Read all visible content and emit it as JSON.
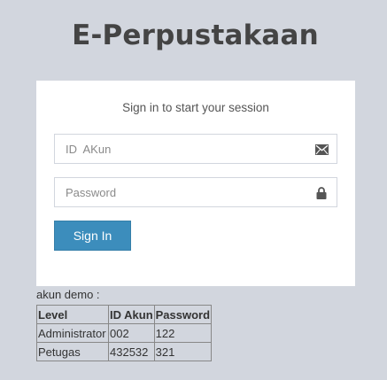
{
  "app": {
    "title": "E-Perpustakaan"
  },
  "login": {
    "message": "Sign in to start your session",
    "id_field": {
      "placeholder": "ID  AKun",
      "value": ""
    },
    "password_field": {
      "placeholder": "Password",
      "value": ""
    },
    "submit_label": "Sign In"
  },
  "icons": {
    "id_field_icon": "envelope-icon",
    "password_field_icon": "lock-icon"
  },
  "colors": {
    "background": "#d2d6de",
    "primary_button": "#3c8dbc"
  },
  "demo": {
    "label": "akun demo :",
    "headers": [
      "Level",
      "ID Akun",
      "Password"
    ],
    "rows": [
      [
        "Administrator",
        "002",
        "122"
      ],
      [
        "Petugas",
        "432532",
        "321"
      ]
    ]
  }
}
